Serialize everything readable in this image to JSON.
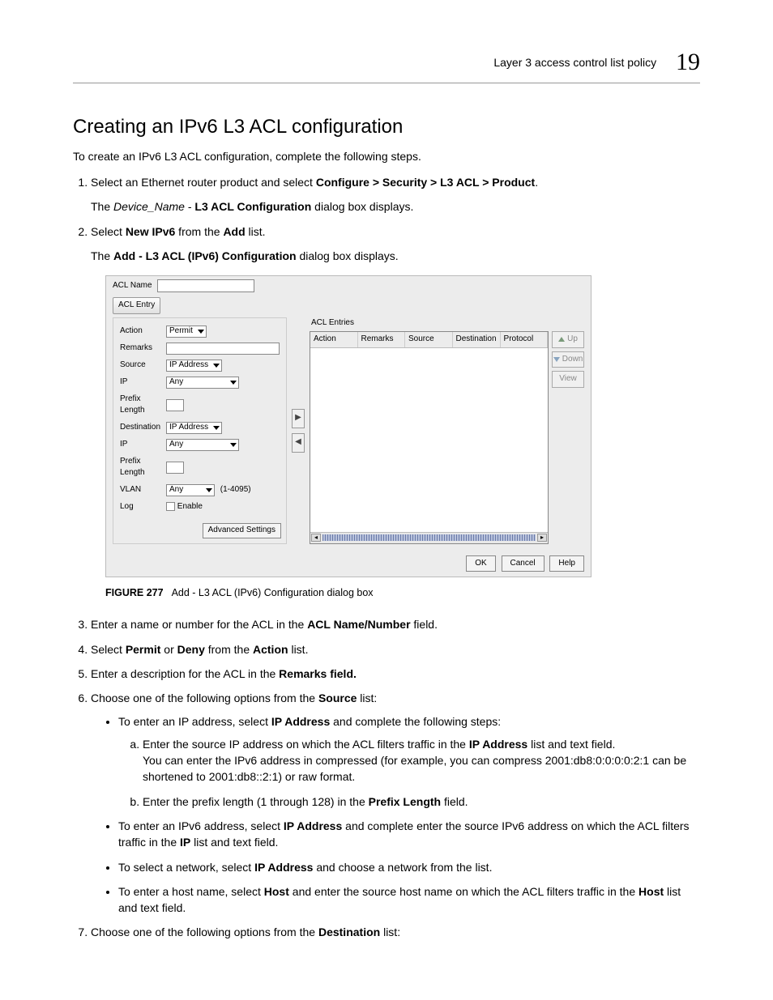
{
  "header": {
    "running_title": "Layer 3 access control list policy",
    "chapter_number": "19"
  },
  "section": {
    "title": "Creating an IPv6 L3 ACL configuration",
    "intro": "To create an IPv6 L3 ACL configuration, complete the following steps."
  },
  "steps": {
    "s1_pre": "Select an Ethernet router product and select ",
    "s1_path": "Configure > Security > L3 ACL > Product",
    "s1_post": ".",
    "s1_sub_pre": "The ",
    "s1_sub_italic": "Device_Name",
    "s1_sub_mid": " - ",
    "s1_sub_bold": "L3 ACL Configuration",
    "s1_sub_post": " dialog box displays.",
    "s2_pre": "Select ",
    "s2_b1": "New IPv6",
    "s2_mid": " from the ",
    "s2_b2": "Add",
    "s2_post": " list.",
    "s2_sub_pre": "The ",
    "s2_sub_bold": "Add - L3 ACL (IPv6) Configuration",
    "s2_sub_post": " dialog box displays.",
    "s3_pre": "Enter a name or number for the ACL in the ",
    "s3_b": "ACL Name/Number",
    "s3_post": " field.",
    "s4_pre": "Select ",
    "s4_b1": "Permit",
    "s4_mid1": " or ",
    "s4_b2": "Deny",
    "s4_mid2": " from the ",
    "s4_b3": "Action",
    "s4_post": " list.",
    "s5_pre": "Enter a description for the ACL in the ",
    "s5_b": "Remarks field.",
    "s6_pre": "Choose one of the following options from the ",
    "s6_b": "Source",
    "s6_post": " list:",
    "s7_pre": "Choose one of the following options from the ",
    "s7_b": "Destination",
    "s7_post": " list:"
  },
  "bullets6": {
    "b1_pre": "To enter an IP address, select ",
    "b1_bold": "IP Address",
    "b1_post": " and complete the following steps:",
    "b1_a_pre": "Enter the source IP address on which the ACL filters traffic in the ",
    "b1_a_bold": "IP Address",
    "b1_a_post": " list and text field.",
    "b1_a_note": "You can enter the IPv6 address in compressed (for example, you can compress 2001:db8:0:0:0:0:2:1 can be shortened to 2001:db8::2:1) or raw format.",
    "b1_b_pre": "Enter the prefix length (1 through 128) in the ",
    "b1_b_bold": "Prefix Length",
    "b1_b_post": " field.",
    "b2_pre": "To enter an IPv6 address, select ",
    "b2_bold1": "IP Address",
    "b2_mid": " and complete enter the source IPv6 address on which the ACL filters traffic in the ",
    "b2_bold2": "IP",
    "b2_post": " list and text field.",
    "b3_pre": "To select a network, select ",
    "b3_bold": "IP Address",
    "b3_post": " and choose a network from the list.",
    "b4_pre": "To enter a host name, select ",
    "b4_bold1": "Host",
    "b4_mid": " and enter the source host name on which the ACL filters traffic in the ",
    "b4_bold2": "Host",
    "b4_post": " list and text field."
  },
  "dialog": {
    "acl_name_label": "ACL Name",
    "acl_entry_tab": "ACL Entry",
    "entries_title": "ACL Entries",
    "labels": {
      "action": "Action",
      "remarks": "Remarks",
      "source": "Source",
      "ip": "IP",
      "prefix_length": "Prefix Length",
      "destination": "Destination",
      "vlan": "VLAN",
      "log": "Log"
    },
    "values": {
      "action": "Permit",
      "source": "IP Address",
      "ip1": "Any",
      "destination": "IP Address",
      "ip2": "Any",
      "vlan": "Any",
      "vlan_range": "(1-4095)",
      "log_enable": "Enable"
    },
    "adv_button": "Advanced Settings",
    "cols": {
      "c1": "Action",
      "c2": "Remarks",
      "c3": "Source",
      "c4": "Destination",
      "c5": "Protocol"
    },
    "side": {
      "up": "Up",
      "down": "Down",
      "view": "View"
    },
    "footer": {
      "ok": "OK",
      "cancel": "Cancel",
      "help": "Help"
    }
  },
  "figure": {
    "num": "FIGURE 277",
    "caption": "Add - L3 ACL (IPv6) Configuration dialog box"
  }
}
